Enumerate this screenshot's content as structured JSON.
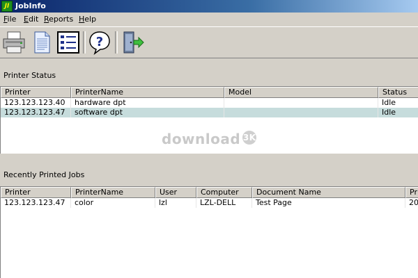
{
  "window": {
    "title": "JobInfo",
    "icon_text": "JI"
  },
  "menu": [
    {
      "label": "File"
    },
    {
      "label": "Edit"
    },
    {
      "label": "Reports"
    },
    {
      "label": "Help"
    }
  ],
  "toolbar": {
    "buttons": [
      {
        "icon": "printer-icon"
      },
      {
        "icon": "document-icon"
      },
      {
        "icon": "details-list-icon"
      },
      {
        "icon": "help-icon"
      },
      {
        "icon": "exit-door-icon"
      }
    ]
  },
  "printer_status": {
    "label": "Printer Status",
    "columns": [
      "Printer",
      "PrinterName",
      "Model",
      "Status"
    ],
    "rows": [
      {
        "printer": "123.123.123.40",
        "name": "hardware dpt",
        "model": "",
        "status": "Idle",
        "selected": false
      },
      {
        "printer": "123.123.123.47",
        "name": "software dpt",
        "model": "",
        "status": "Idle",
        "selected": true
      }
    ]
  },
  "recent_jobs": {
    "label": "Recently Printed Jobs",
    "columns": [
      "Printer",
      "PrinterName",
      "User",
      "Computer",
      "Document Name",
      "Pri"
    ],
    "rows": [
      {
        "printer": "123.123.123.47",
        "name": "color",
        "user": "lzl",
        "computer": "LZL-DELL",
        "document": "Test Page",
        "time": "20"
      }
    ]
  },
  "watermark": {
    "text": "download",
    "badge": "3K"
  }
}
